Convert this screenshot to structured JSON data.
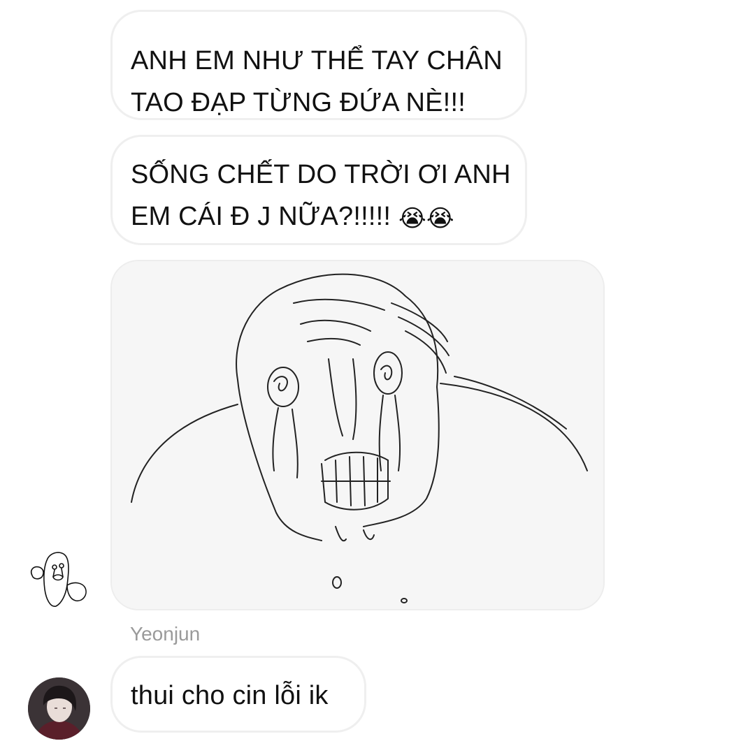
{
  "messages": [
    {
      "id": "msg1",
      "type": "text",
      "lines": [
        "ANH EM NHƯ THỂ TAY CHÂN",
        "TAO ĐẠP TỪNG ĐỨA NÈ!!!"
      ]
    },
    {
      "id": "msg2",
      "type": "text",
      "lines": [
        "SỐNG CHẾT DO TRỜI ƠI ANH",
        "EM CÁI Đ J NỮA?!!!!! "
      ],
      "emoji": "😭😭"
    },
    {
      "id": "msg3",
      "type": "image",
      "icon": "crying-meme-drawing"
    },
    {
      "id": "msg4",
      "type": "text",
      "sender": "Yeonjun",
      "lines": [
        "thui cho cin lỗi ik"
      ]
    }
  ],
  "avatars": {
    "sticker": "crying-sticker-avatar",
    "yeonjun": "yeonjun-profile-photo"
  },
  "colors": {
    "background": "#ffffff",
    "bubble_border": "#efefef",
    "sender_name": "#9a9a9a",
    "text": "#111111"
  }
}
